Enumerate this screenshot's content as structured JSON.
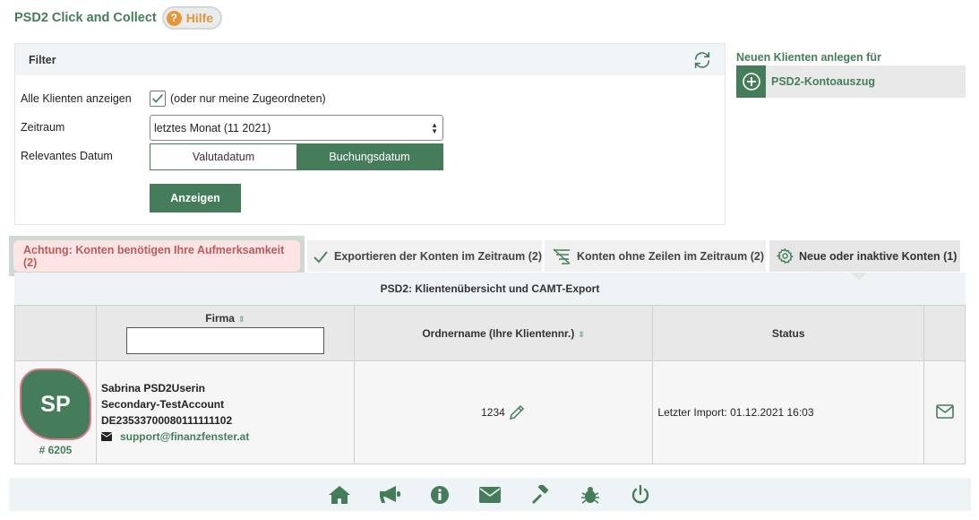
{
  "header": {
    "title": "PSD2 Click and Collect",
    "help_label": "Hilfe"
  },
  "filter": {
    "title": "Filter",
    "all_clients_label": "Alle Klienten anzeigen",
    "all_clients_checked": true,
    "all_clients_hint": "(oder nur meine Zugeordneten)",
    "period_label": "Zeitraum",
    "period_value": "letztes Monat (11 2021)",
    "relevant_date_label": "Relevantes Datum",
    "date_options": [
      "Valutadatum",
      "Buchungsdatum"
    ],
    "date_selected": "Buchungsdatum",
    "show_button": "Anzeigen"
  },
  "new_client": {
    "title": "Neuen Klienten anlegen für",
    "item_label": "PSD2-Kontoauszug"
  },
  "tabs": [
    {
      "label": "Achtung: Konten benötigen Ihre Aufmerksamkeit (2)",
      "icon": ""
    },
    {
      "label": "Exportieren der Konten im Zeitraum (2)",
      "icon": "check-icon"
    },
    {
      "label": "Konten ohne Zeilen im Zeitraum (2)",
      "icon": "no-lines-icon"
    },
    {
      "label": "Neue oder inaktive Konten (1)",
      "icon": "gear-icon",
      "active": true
    }
  ],
  "table": {
    "caption": "PSD2: Klientenübersicht und CAMT-Export",
    "columns": [
      "",
      "Firma",
      "Ordnername (Ihre Klientennr.)",
      "Status",
      ""
    ],
    "rows": [
      {
        "avatar_initials": "SP",
        "client_number": "# 6205",
        "name": "Sabrina PSD2Userin",
        "account": "Secondary-TestAccount",
        "iban": "DE23533700080111111102",
        "email": "support@finanzfenster.at",
        "folder": "1234",
        "status": "Letzter Import: 01.12.2021 16:03"
      }
    ]
  },
  "footer": {
    "icons": [
      "home-icon",
      "megaphone-icon",
      "info-icon",
      "mail-icon",
      "gavel-icon",
      "bug-icon",
      "power-icon"
    ]
  },
  "colors": {
    "brand_green": "#457d5b",
    "help_orange": "#e8953a",
    "attention_text": "#b85c5c"
  }
}
